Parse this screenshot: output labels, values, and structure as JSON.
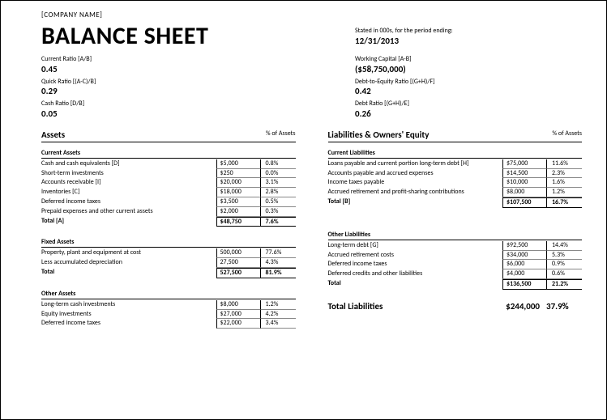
{
  "company": "[COMPANY NAME]",
  "title": "BALANCE SHEET",
  "period": {
    "label": "Stated in 000s, for the period ending:",
    "value": "12/31/2013"
  },
  "ratios_left": [
    {
      "label": "Current Ratio   [A/B]",
      "value": "0.45"
    },
    {
      "label": "Quick Ratio   [(A-C)/B]",
      "value": "0.29"
    },
    {
      "label": "Cash Ratio   [D/B]",
      "value": "0.05"
    }
  ],
  "ratios_right": [
    {
      "label": "Working Capital   [A-B]",
      "value": "($58,750,000)"
    },
    {
      "label": "Debt-to-Equity Ratio   [(G+H)/F]",
      "value": "0.42"
    },
    {
      "label": "Debt Ratio   [(G+H)/E]",
      "value": "0.26"
    }
  ],
  "assets": {
    "heading": "Assets",
    "pct_heading": "% of Assets",
    "groups": [
      {
        "title": "Current Assets",
        "rows": [
          {
            "label": "Cash and cash equivalents   [D]",
            "value": "$5,000",
            "pct": "0.8%"
          },
          {
            "label": "Short-term investments",
            "value": "$250",
            "pct": "0.0%"
          },
          {
            "label": "Accounts receivable   [I]",
            "value": "$20,000",
            "pct": "3.1%"
          },
          {
            "label": "Inventories   [C]",
            "value": "$18,000",
            "pct": "2.8%"
          },
          {
            "label": "Deferred income taxes",
            "value": "$3,500",
            "pct": "0.5%"
          },
          {
            "label": "Prepaid expenses and other current assets",
            "value": "$2,000",
            "pct": "0.3%"
          }
        ],
        "total": {
          "label": "Total   [A]",
          "value": "$48,750",
          "pct": "7.6%"
        }
      },
      {
        "title": "Fixed Assets",
        "rows": [
          {
            "label": "Property, plant and equipment at cost",
            "value": "500,000",
            "pct": "77.6%"
          },
          {
            "label": "Less accumulated depreciation",
            "value": "27,500",
            "pct": "4.3%"
          }
        ],
        "total": {
          "label": "Total",
          "value": "527,500",
          "pct": "81.9%"
        }
      },
      {
        "title": "Other Assets",
        "rows": [
          {
            "label": "Long-term cash investments",
            "value": "$8,000",
            "pct": "1.2%"
          },
          {
            "label": "Equity investments",
            "value": "$27,000",
            "pct": "4.2%"
          },
          {
            "label": "Deferred income taxes",
            "value": "$22,000",
            "pct": "3.4%"
          }
        ]
      }
    ]
  },
  "liabilities": {
    "heading": "Liabilities & Owners' Equity",
    "pct_heading": "% of Assets",
    "groups": [
      {
        "title": "Current Liabilities",
        "rows": [
          {
            "label": "Loans payable and current portion long-term debt   [H]",
            "value": "$75,000",
            "pct": "11.6%"
          },
          {
            "label": "Accounts payable and accrued expenses",
            "value": "$14,500",
            "pct": "2.3%"
          },
          {
            "label": "Income taxes payable",
            "value": "$10,000",
            "pct": "1.6%"
          },
          {
            "label": "Accrued retirement and profit-sharing contributions",
            "value": "$8,000",
            "pct": "1.2%"
          }
        ],
        "total": {
          "label": "Total   [B]",
          "value": "$107,500",
          "pct": "16.7%"
        }
      },
      {
        "title": "Other Liabilities",
        "rows": [
          {
            "label": "Long-term debt   [G]",
            "value": "$92,500",
            "pct": "14.4%"
          },
          {
            "label": "Accrued retirement costs",
            "value": "$34,000",
            "pct": "5.3%"
          },
          {
            "label": "Deferred income taxes",
            "value": "$6,000",
            "pct": "0.9%"
          },
          {
            "label": "Deferred credits and other liabilities",
            "value": "$4,000",
            "pct": "0.6%"
          }
        ],
        "total": {
          "label": "Total",
          "value": "$136,500",
          "pct": "21.2%"
        }
      }
    ],
    "grand_total": {
      "label": "Total Liabilities",
      "value": "$244,000",
      "pct": "37.9%"
    }
  }
}
